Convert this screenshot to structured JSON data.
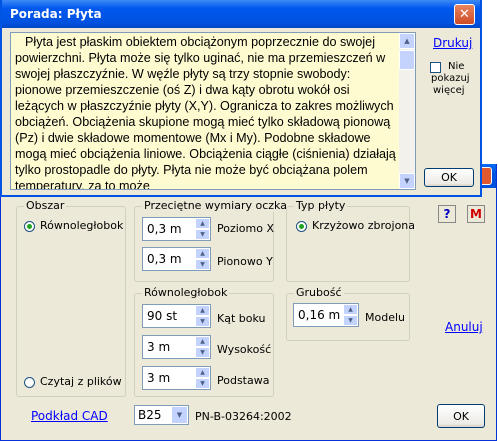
{
  "hint": {
    "title": "Porada: Płyta",
    "close_glyph": "✕",
    "text": "Płyta jest płaskim obiektem obciążonym poprzecznie do swojej powierzchni. Płyta może się tylko uginać, nie ma przemieszczeń w swojej płaszczyźnie. W węźle płyty są trzy stopnie swobody: pionowe przemieszczenie (oś Z) i dwa kąty obrotu wokół osi leżących w płaszczyźnie płyty (X,Y). Ogranicza to zakres możliwych obciążeń. Obciążenia skupione mogą mieć tylko składową pionową (Pz) i dwie składowe momentowe (Mx i My). Podobne składowe mogą mieć obciążenia liniowe. Obciążenia ciągłe (ciśnienia) działają tylko prostopadle do płyty. Płyta nie może być obciążana polem temperatury, za to może",
    "print_link": "Drukuj",
    "dont_show_label": [
      "Nie",
      "pokazuj",
      "więcej"
    ],
    "ok_label": "OK"
  },
  "dialog": {
    "area_group": {
      "title": "Obszar",
      "option_parallelogram": "Równoległobok",
      "option_from_files": "Czytaj z plików",
      "selected": "Równoległobok"
    },
    "avg_cell_group": {
      "title": "Przeciętne wymiary oczka",
      "horizontal_value": "0,3 m",
      "horizontal_label": "Poziomo X",
      "vertical_value": "0,3 m",
      "vertical_label": "Pionowo Y"
    },
    "plate_type_group": {
      "title": "Typ płyty",
      "option": "Krzyżowo zbrojona"
    },
    "parallelogram_group": {
      "title": "Równoległobok",
      "angle_value": "90 st",
      "angle_label": "Kąt boku",
      "height_value": "3 m",
      "height_label": "Wysokość",
      "base_value": "3 m",
      "base_label": "Podstawa"
    },
    "thickness_group": {
      "title": "Grubość",
      "value": "0,16 m",
      "label": "Modelu"
    },
    "cad_link": "Podkład CAD",
    "concrete_class": "B25",
    "standard": "PN-B-03264:2002",
    "help_button": "?",
    "m_button": "M",
    "cancel_link": "Anuluj",
    "ok_label": "OK"
  },
  "colors": {
    "titlebar": "#0054e3",
    "hint_text_bg": "#fffbd1",
    "dialog_bg": "#ece9d8",
    "link": "#0000ff"
  }
}
